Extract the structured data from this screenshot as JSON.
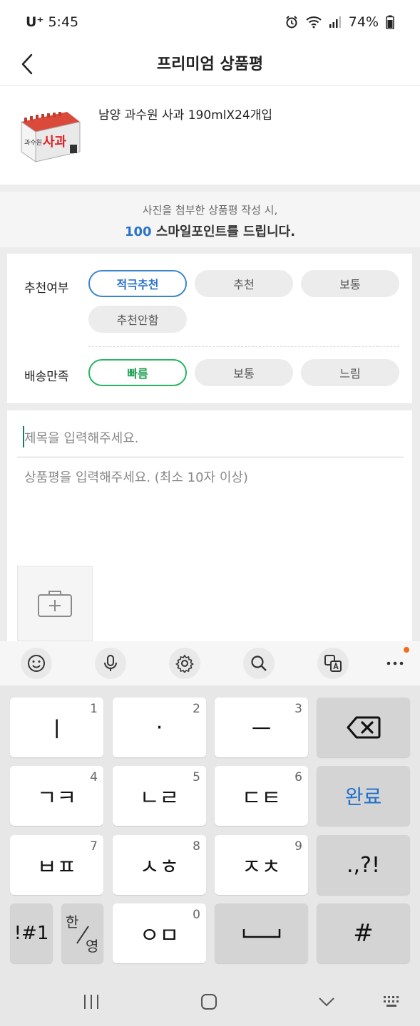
{
  "status_bar": {
    "carrier": "U⁺",
    "time": "5:45",
    "battery": "74%"
  },
  "header": {
    "title": "프리미엄 상품평"
  },
  "product": {
    "name": "남양  과수원 사과 190mlX24개입",
    "image_text": "과수원 사과"
  },
  "notice": {
    "line1": "사진을 첨부한 상품평 작성 시,",
    "points": "100",
    "line2_rest": " 스마일포인트를 드립니다."
  },
  "rating": {
    "recommend_label": "추천여부",
    "recommend_options": [
      "적극추천",
      "추천",
      "보통",
      "추천안함"
    ],
    "recommend_selected": "적극추천",
    "delivery_label": "배송만족",
    "delivery_options": [
      "빠름",
      "보통",
      "느림"
    ],
    "delivery_selected": "빠름"
  },
  "form": {
    "title_placeholder": "제목을 입력해주세요.",
    "body_placeholder": "상품평을 입력해주세요. (최소 10자 이상)"
  },
  "keyboard": {
    "toolbar_icons": [
      "emoji-icon",
      "microphone-icon",
      "settings-icon",
      "search-icon",
      "translate-icon",
      "more-icon"
    ],
    "rows": [
      [
        {
          "label": "ㅣ",
          "num": "1"
        },
        {
          "label": "·",
          "num": "2"
        },
        {
          "label": "ㅡ",
          "num": "3"
        },
        {
          "label": "",
          "num": ""
        }
      ],
      [
        {
          "label": "ㄱㅋ",
          "num": "4"
        },
        {
          "label": "ㄴㄹ",
          "num": "5"
        },
        {
          "label": "ㄷㅌ",
          "num": "6"
        },
        {
          "label": "완료",
          "num": ""
        }
      ],
      [
        {
          "label": "ㅂㅍ",
          "num": "7"
        },
        {
          "label": "ㅅㅎ",
          "num": "8"
        },
        {
          "label": "ㅈㅊ",
          "num": "9"
        },
        {
          "label": ".,?!",
          "num": ""
        }
      ],
      [
        {
          "label": "!#1",
          "num": ""
        },
        {
          "label": "한/영",
          "num": ""
        },
        {
          "label": "ㅇㅁ",
          "num": "0"
        },
        {
          "label": "",
          "num": ""
        },
        {
          "label": "#",
          "num": ""
        }
      ]
    ],
    "han_top": "한",
    "han_bottom": "영"
  },
  "colors": {
    "accent_blue": "#2b73c8",
    "accent_green": "#1fa155",
    "notification_dot": "#ef6c1d"
  }
}
